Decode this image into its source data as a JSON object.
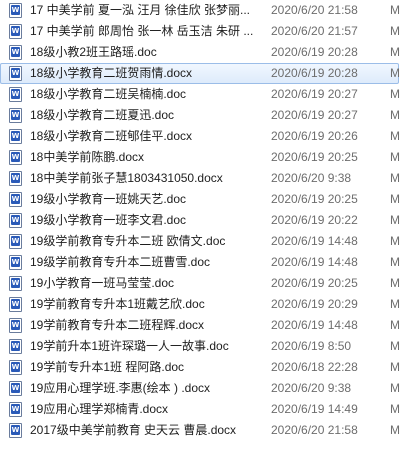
{
  "files": [
    {
      "name": "17 中美学前 夏一泓 汪月 徐佳欣 张梦丽...",
      "modified": "2020/6/20 21:58",
      "type": "M",
      "selected": false
    },
    {
      "name": "17 中美学前 郎周怡 张一林 岳玉洁 朱研 ...",
      "modified": "2020/6/20 21:57",
      "type": "M",
      "selected": false
    },
    {
      "name": "18级小教2班王路瑶.doc",
      "modified": "2020/6/19 20:28",
      "type": "M",
      "selected": false
    },
    {
      "name": "18级小学教育二班贺雨情.docx",
      "modified": "2020/6/19 20:28",
      "type": "M",
      "selected": true
    },
    {
      "name": "18级小学教育二班吴楠楠.doc",
      "modified": "2020/6/19 20:27",
      "type": "M",
      "selected": false
    },
    {
      "name": "18级小学教育二班夏迅.doc",
      "modified": "2020/6/19 20:27",
      "type": "M",
      "selected": false
    },
    {
      "name": "18级小学教育二班郇佳平.docx",
      "modified": "2020/6/19 20:26",
      "type": "M",
      "selected": false
    },
    {
      "name": "18中美学前陈鹏.docx",
      "modified": "2020/6/19 20:25",
      "type": "M",
      "selected": false
    },
    {
      "name": "18中美学前张子慧1803431050.docx",
      "modified": "2020/6/20 9:38",
      "type": "M",
      "selected": false
    },
    {
      "name": "19级小学教育一班姚天艺.doc",
      "modified": "2020/6/19 20:25",
      "type": "M",
      "selected": false
    },
    {
      "name": "19级小学教育一班李文君.doc",
      "modified": "2020/6/19 20:22",
      "type": "M",
      "selected": false
    },
    {
      "name": "19级学前教育专升本二班 欧倩文.doc",
      "modified": "2020/6/19 14:48",
      "type": "M",
      "selected": false
    },
    {
      "name": "19级学前教育专升本二班曹雪.doc",
      "modified": "2020/6/19 14:48",
      "type": "M",
      "selected": false
    },
    {
      "name": "19小学教育一班马莹莹.doc",
      "modified": "2020/6/19 20:25",
      "type": "M",
      "selected": false
    },
    {
      "name": "19学前教育专升本1班戴艺欣.doc",
      "modified": "2020/6/19 20:29",
      "type": "M",
      "selected": false
    },
    {
      "name": "19学前教育专升本二班程辉.docx",
      "modified": "2020/6/19 14:48",
      "type": "M",
      "selected": false
    },
    {
      "name": "19学前升本1班许琛璐一人一故事.doc",
      "modified": "2020/6/19 8:50",
      "type": "M",
      "selected": false
    },
    {
      "name": "19学前专升本1班 程阿路.doc",
      "modified": "2020/6/18 22:28",
      "type": "M",
      "selected": false
    },
    {
      "name": "19应用心理学班.李惠(绘本 ) .docx",
      "modified": "2020/6/20 9:38",
      "type": "M",
      "selected": false
    },
    {
      "name": "19应用心理学郑楠青.docx",
      "modified": "2020/6/19 14:49",
      "type": "M",
      "selected": false
    },
    {
      "name": "2017级中美学前教育 史天云 曹晨.docx",
      "modified": "2020/6/20 21:58",
      "type": "M",
      "selected": false
    }
  ]
}
